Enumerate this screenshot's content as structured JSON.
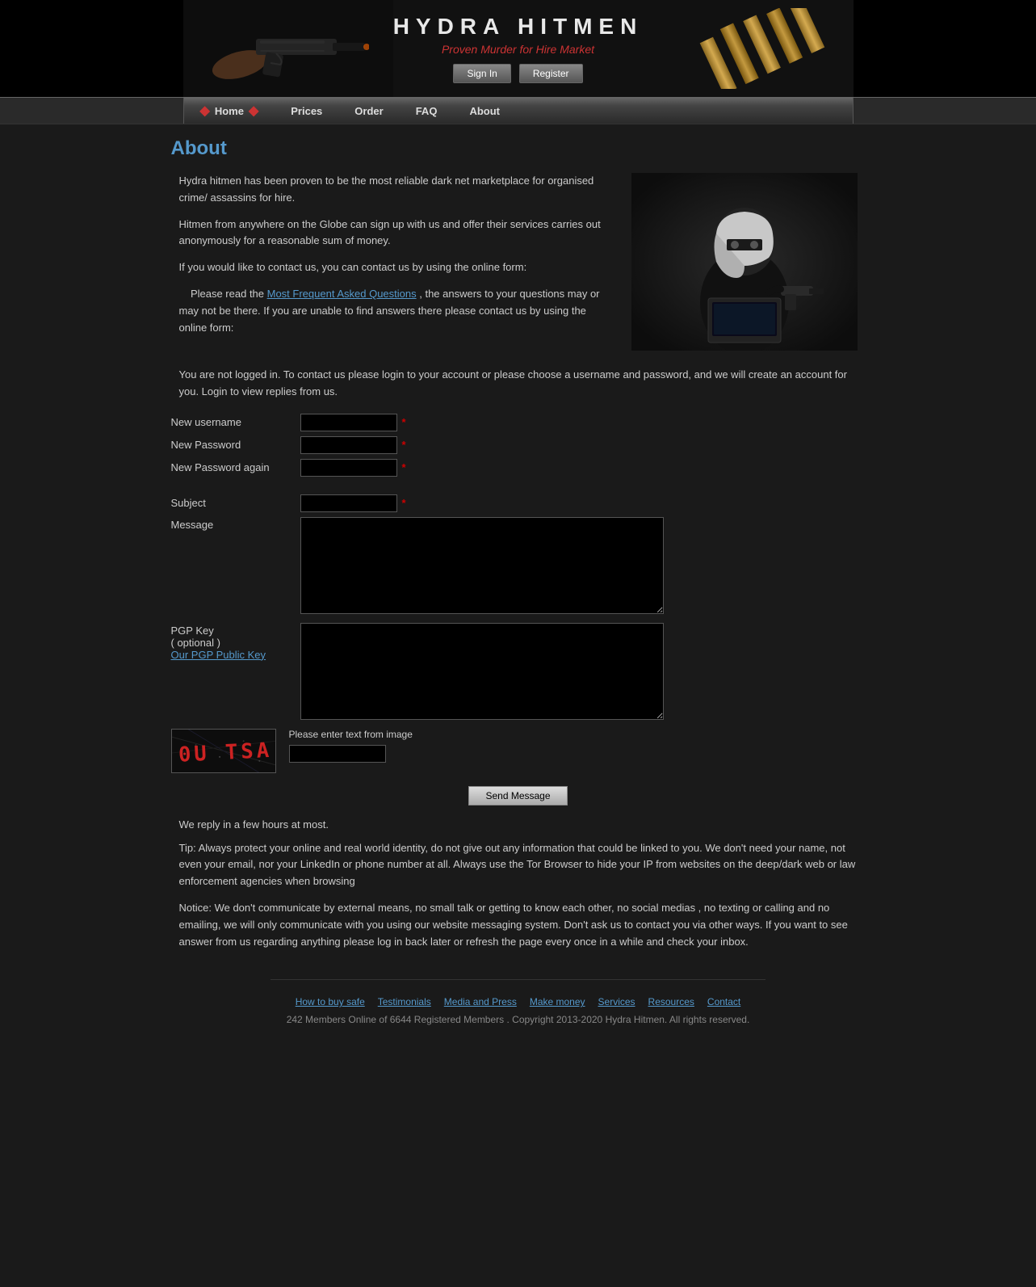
{
  "site": {
    "title": "HYDRA   HITMEN",
    "subtitle": "Proven Murder for Hire Market",
    "captcha_value": "0U TSA"
  },
  "header": {
    "signin_label": "Sign In",
    "register_label": "Register"
  },
  "nav": {
    "items": [
      {
        "label": "Home"
      },
      {
        "label": "Prices"
      },
      {
        "label": "Order"
      },
      {
        "label": "FAQ"
      },
      {
        "label": "About"
      }
    ]
  },
  "page": {
    "title": "About",
    "para1": "Hydra hitmen has been proven to be the most reliable dark net marketplace for organised crime/ assassins for hire.",
    "para2": "Hitmen from anywhere on the Globe can sign up with us and offer their services carries out anonymously for a reasonable sum of money.",
    "para3": "If you would like to contact us, you can contact us by using the online form:",
    "para4_pre": "Please read the ",
    "para4_link": "Most Frequent Asked Questions",
    "para4_post": " , the answers to your questions may or may not be there. If you are unable to find answers there please contact us by using the online form:",
    "not_logged_in": "You are not logged in. To contact us please login to your account or please choose a username and password, and we will create an account for you. Login to view replies from us."
  },
  "form": {
    "new_username_label": "New username",
    "new_password_label": "New Password",
    "new_password_again_label": "New Password again",
    "subject_label": "Subject",
    "message_label": "Message",
    "pgp_key_label": "PGP Key",
    "pgp_optional": "( optional )",
    "pgp_link": "Our PGP Public Key",
    "captcha_hint": "Please enter text from image",
    "send_button": "Send Message",
    "required_marker": "*"
  },
  "info": {
    "reply_text": "We reply in a few hours at most.",
    "tip": "Tip: Always protect your online and real world identity, do not give out any information that could be linked to you. We don't need your name, not even your email, nor your LinkedIn or phone number at all. Always use the Tor Browser to hide your IP from websites on the deep/dark web or law enforcement agencies when browsing",
    "notice": "Notice: We don't communicate by external means, no small talk or getting to know each other, no social medias , no texting or calling and no emailing, we will only communicate with you using our website messaging system. Don't ask us to contact you via other ways. If you want to see answer from us regarding anything please log in back later or refresh the page every once in a while and check your inbox."
  },
  "footer": {
    "links": [
      "How to buy safe",
      "Testimonials",
      "Media and Press",
      "Make money",
      "Services",
      "Resources",
      "Contact"
    ],
    "copyright": "242 Members Online of 6644 Registered Members . Copyright 2013-2020 Hydra Hitmen. All rights reserved."
  }
}
